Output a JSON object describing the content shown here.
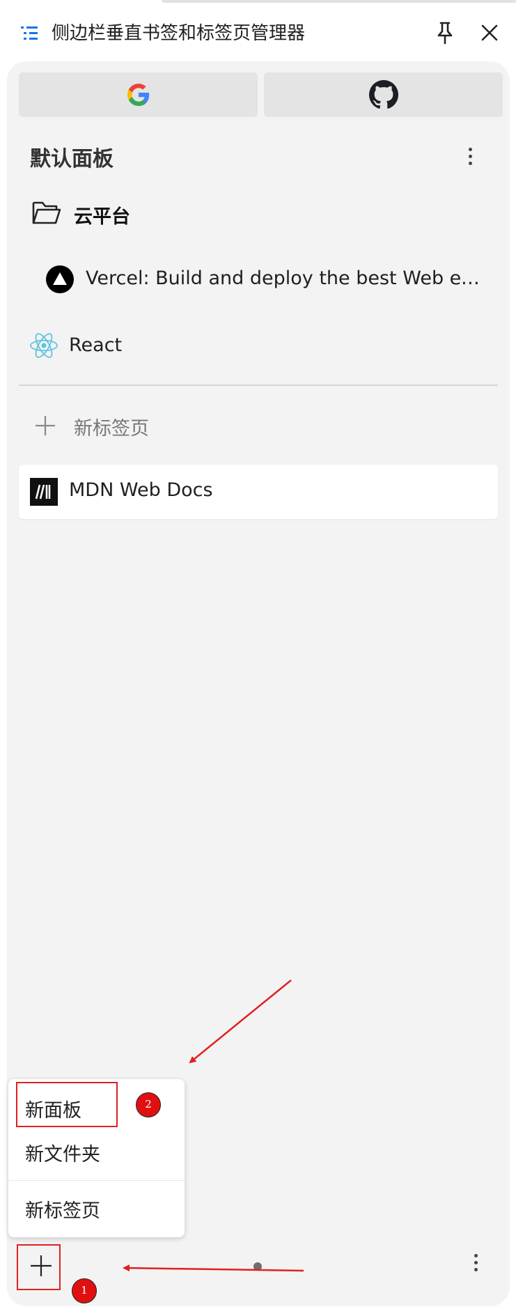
{
  "window": {
    "title": "侧边栏垂直书签和标签页管理器",
    "icons": [
      "list-icon",
      "pin-icon",
      "close-icon"
    ]
  },
  "quick_access": [
    {
      "name": "Google",
      "icon": "google-icon"
    },
    {
      "name": "GitHub",
      "icon": "github-icon"
    }
  ],
  "board": {
    "title": "默认面板",
    "folder": {
      "label": "云平台",
      "icon": "folder-open-icon"
    },
    "bookmarks": [
      {
        "label": "Vercel: Build and deploy the best Web experiences with the Frontend Cloud",
        "icon": "vercel-icon"
      },
      {
        "label": "React",
        "icon": "react-icon"
      }
    ]
  },
  "tabs": {
    "new_tab_label": "新标签页",
    "open": [
      {
        "label": "MDN Web Docs",
        "icon": "mdn-icon"
      }
    ]
  },
  "context_menu": {
    "items": [
      "新面板",
      "新文件夹",
      "新标签页"
    ]
  },
  "annotations": {
    "badge_1": "1",
    "badge_2": "2",
    "color": "#e02020"
  },
  "colors": {
    "accent": "#1a73e8",
    "panel_bg": "#f3f3f3",
    "annotation_red": "#e02020",
    "react_cyan": "#61c3e0"
  }
}
